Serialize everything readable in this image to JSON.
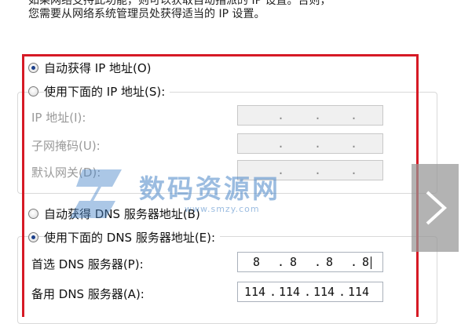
{
  "intro": {
    "line1": "如果网络支持此功能，则可以获取自动指派的 IP 设置。否则，",
    "line2": "您需要从网络系统管理员处获得适当的 IP 设置。"
  },
  "ip": {
    "auto_label": "自动获得 IP 地址(O)",
    "manual_label": "使用下面的 IP 地址(S):",
    "address_label": "IP 地址(I):",
    "subnet_label": "子网掩码(U):",
    "gateway_label": "默认网关(D):"
  },
  "dns": {
    "auto_label": "自动获得 DNS 服务器地址(B)",
    "manual_label": "使用下面的 DNS 服务器地址(E):",
    "preferred_label": "首选 DNS 服务器(P):",
    "alternate_label": "备用 DNS 服务器(A):",
    "preferred_octets": [
      "8",
      "8",
      "8",
      "8"
    ],
    "alternate_octets": [
      "114",
      "114",
      "114",
      "114"
    ]
  },
  "watermark": {
    "text": "数码资源网",
    "url": "www.smzy.com"
  },
  "colors": {
    "highlight": "#d61a25",
    "watermark": "#4a86c8",
    "radio_dot": "#1b3f8a"
  }
}
